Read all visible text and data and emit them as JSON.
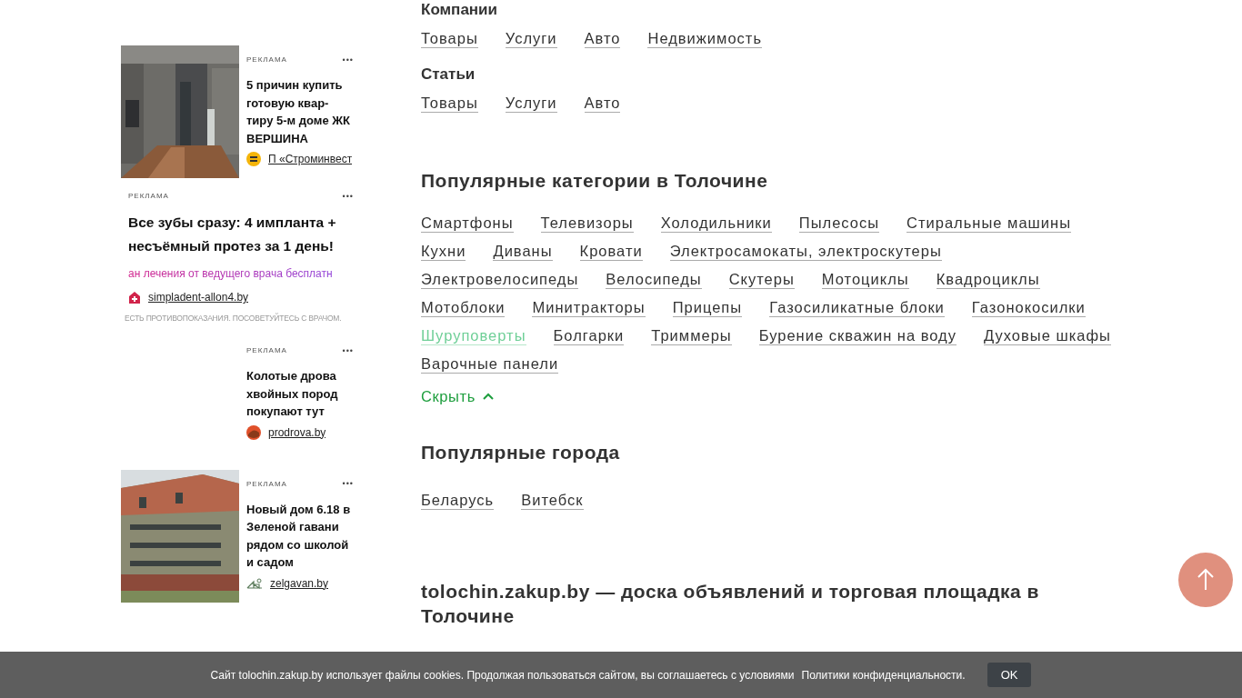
{
  "ads": [
    {
      "label": "РЕКЛАМА",
      "menu": "•••",
      "title": "5 причин купить готовую квар-тиру 5-м доме ЖК ВЕРШИНА",
      "source": "П «Строминвест"
    },
    {
      "kind": "wide",
      "label": "РЕКЛАМА",
      "menu": "•••",
      "title": "Все зубы сразу: 4 импланта + несъёмный протез за 1 день!",
      "subtitle": "ан лечения от ведущего врача бесплатн",
      "source": "simpladent-allon4.by",
      "disclaimer": "ЕСТЬ ПРОТИВОПОКАЗАНИЯ. ПОСОВЕТУЙТЕСЬ С ВРАЧОМ."
    },
    {
      "kind": "blank",
      "label": "РЕКЛАМА",
      "menu": "•••",
      "title": "Колотые дрова хвойных пород покупают тут",
      "source": "prodrova.by"
    },
    {
      "label": "РЕКЛАМА",
      "menu": "•••",
      "title": "Новый дом 6.18 в Зеленой гавани рядом со школой и садом",
      "source": "zelgavan.by"
    }
  ],
  "groups": [
    {
      "title": "Компании",
      "links": [
        "Товары",
        "Услуги",
        "Авто",
        "Недвижимость"
      ]
    },
    {
      "title": "Статьи",
      "links": [
        "Товары",
        "Услуги",
        "Авто"
      ]
    }
  ],
  "categories": {
    "title": "Популярные категории в Толочине",
    "links": [
      {
        "text": "Смартфоны",
        "highlighted": false
      },
      {
        "text": "Телевизоры",
        "highlighted": false
      },
      {
        "text": "Холодильники",
        "highlighted": false
      },
      {
        "text": "Пылесосы",
        "highlighted": false
      },
      {
        "text": "Стиральные машины",
        "highlighted": false
      },
      {
        "text": "Кухни",
        "highlighted": false
      },
      {
        "text": "Диваны",
        "highlighted": false
      },
      {
        "text": "Кровати",
        "highlighted": false
      },
      {
        "text": "Электросамокаты, электроскутеры",
        "highlighted": false
      },
      {
        "text": "Электровелосипеды",
        "highlighted": false
      },
      {
        "text": "Велосипеды",
        "highlighted": false
      },
      {
        "text": "Скутеры",
        "highlighted": false
      },
      {
        "text": "Мотоциклы",
        "highlighted": false
      },
      {
        "text": "Квадроциклы",
        "highlighted": false
      },
      {
        "text": "Мотоблоки",
        "highlighted": false
      },
      {
        "text": "Минитракторы",
        "highlighted": false
      },
      {
        "text": "Прицепы",
        "highlighted": false
      },
      {
        "text": "Газосиликатные блоки",
        "highlighted": false
      },
      {
        "text": "Газонокосилки",
        "highlighted": false
      },
      {
        "text": "Шуруповерты",
        "highlighted": true
      },
      {
        "text": "Болгарки",
        "highlighted": false
      },
      {
        "text": "Триммеры",
        "highlighted": false
      },
      {
        "text": "Бурение скважин на воду",
        "highlighted": false
      },
      {
        "text": "Духовые шкафы",
        "highlighted": false
      },
      {
        "text": "Варочные панели",
        "highlighted": false
      }
    ],
    "toggle": "Скрыть",
    "expanded": true
  },
  "cities": {
    "title": "Популярные города",
    "links": [
      "Беларусь",
      "Витебск"
    ]
  },
  "about": {
    "title": "tolochin.zakup.by — доска объявлений и торговая площадка в Толочине"
  },
  "cookie": {
    "text": "Сайт tolochin.zakup.by использует файлы cookies. Продолжая пользоваться сайтом, вы соглашаетесь с условиями",
    "link": "Политики конфиденциальности.",
    "button": "OK"
  }
}
